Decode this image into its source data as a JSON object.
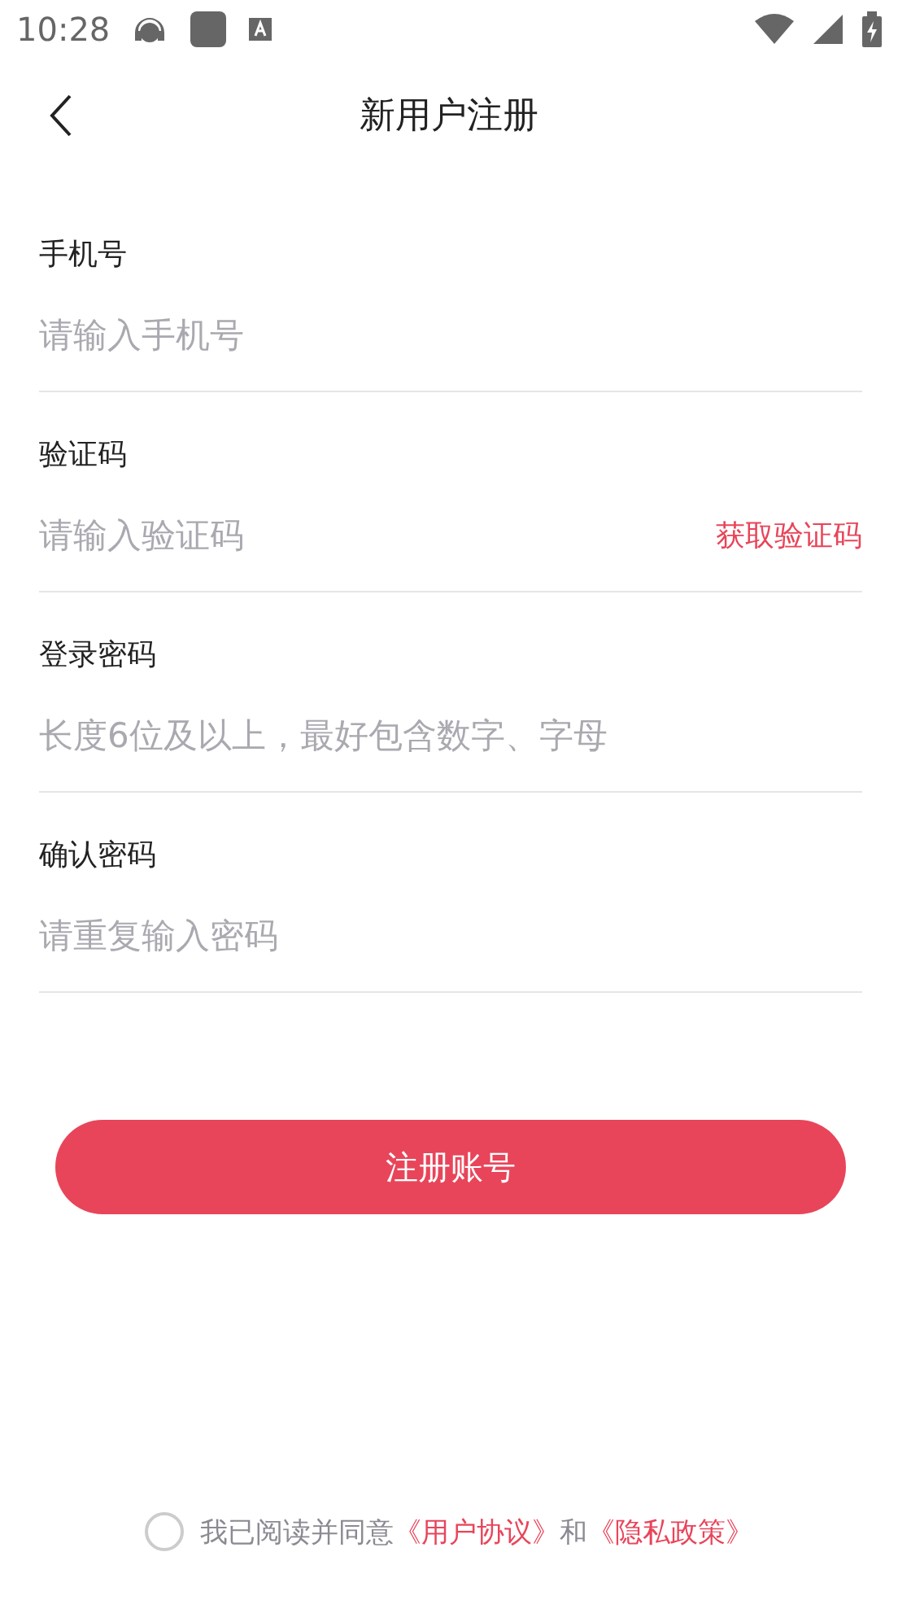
{
  "status_bar": {
    "time": "10:28"
  },
  "header": {
    "title": "新用户注册"
  },
  "fields": [
    {
      "label": "手机号",
      "placeholder": "请输入手机号"
    },
    {
      "label": "验证码",
      "placeholder": "请输入验证码",
      "action": "获取验证码"
    },
    {
      "label": "登录密码",
      "placeholder": "长度6位及以上，最好包含数字、字母"
    },
    {
      "label": "确认密码",
      "placeholder": "请重复输入密码"
    }
  ],
  "submit_button": "注册账号",
  "agreement": {
    "checked": false,
    "text": "我已阅读并同意",
    "link_1": "《用户协议》",
    "joiner": "和",
    "link_2": "《隐私政策》"
  }
}
